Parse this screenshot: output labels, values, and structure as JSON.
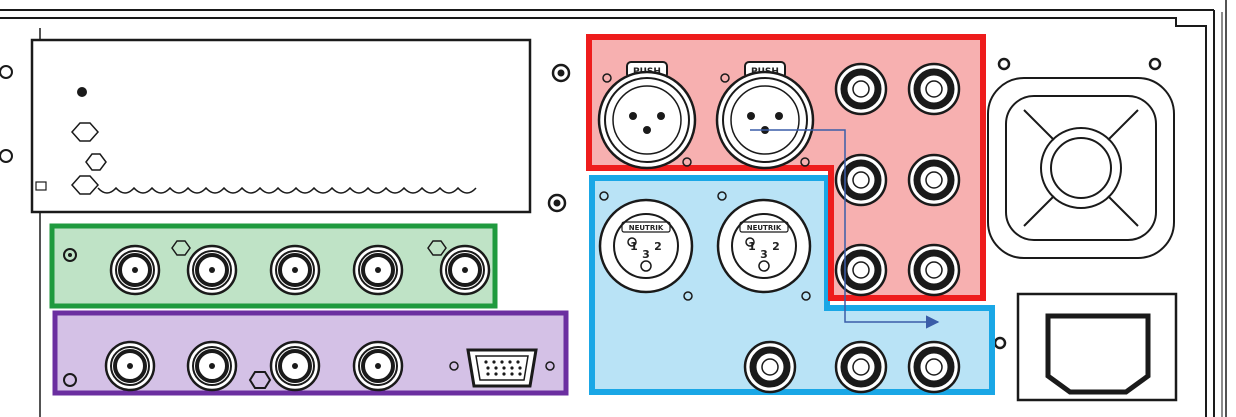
{
  "panel": {
    "xlr_push_label": "PUSH",
    "xlr_neutrik_label": "NEUTRIK",
    "xlr_pins": [
      "1",
      "3",
      "2"
    ]
  },
  "regions": [
    {
      "id": "red",
      "color": "#ee1c1c",
      "fill": "#f7b0b0",
      "content": "XLR input connectors with push latch and 1/4-inch jacks"
    },
    {
      "id": "blue",
      "color": "#1aa7e6",
      "fill": "#b9e3f6",
      "content": "XLR output connectors and 1/4-inch jacks"
    },
    {
      "id": "green",
      "color": "#1f9a3e",
      "fill": "#bfe3c6",
      "content": "row of five BNC connectors"
    },
    {
      "id": "purple",
      "color": "#6b2fa0",
      "fill": "#d4c1e6",
      "content": "four BNC connectors and VGA port"
    }
  ],
  "signal_arrow": {
    "color": "#3a5da8",
    "from": "red",
    "to": "blue"
  }
}
